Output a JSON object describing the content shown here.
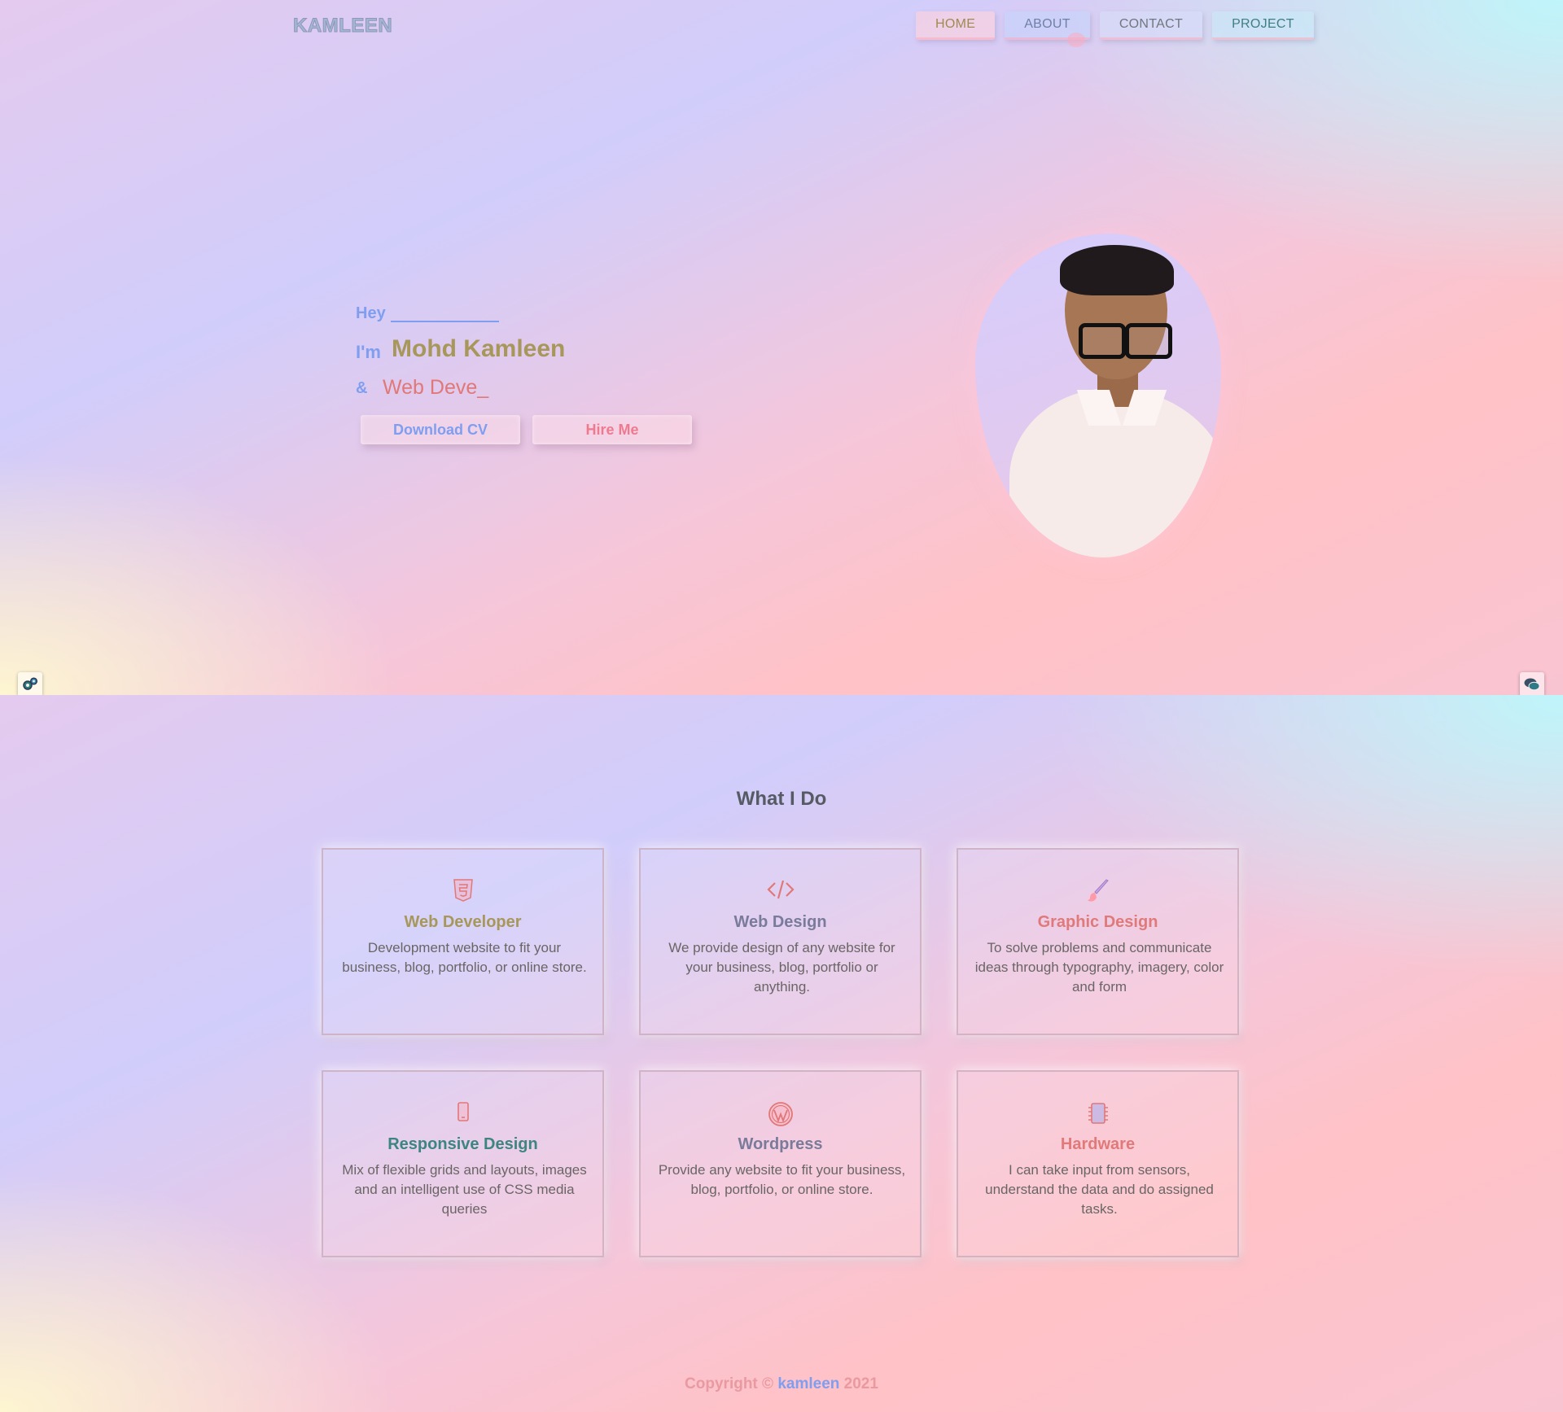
{
  "nav": {
    "logo": "KAMLEEN",
    "items": [
      {
        "label": "HOME"
      },
      {
        "label": "ABOUT"
      },
      {
        "label": "CONTACT"
      },
      {
        "label": "PROJECT"
      }
    ]
  },
  "hero": {
    "hey": "Hey",
    "im": "I'm",
    "name": "Mohd Kamleen",
    "amp": "&",
    "role": "Web Deve_",
    "download_cv": "Download CV",
    "hire_me": "Hire Me"
  },
  "services": {
    "title": "What I Do",
    "cards": [
      {
        "title": "Web Developer",
        "text": "Development website to fit your business, blog, portfolio, or online store.",
        "color": "#a7975a",
        "icon": "html5-icon"
      },
      {
        "title": "Web Design",
        "text": "We provide design of any website for your business, blog, portfolio or anything.",
        "color": "#7a7b9a",
        "icon": "code-icon"
      },
      {
        "title": "Graphic Design",
        "text": "To solve problems and communicate ideas through typography, imagery, color and form",
        "color": "#e07a7a",
        "icon": "paintbrush-icon"
      },
      {
        "title": "Responsive Design",
        "text": "Mix of flexible grids and layouts, images and an intelligent use of CSS media queries",
        "color": "#3d8580",
        "icon": "mobile-icon"
      },
      {
        "title": "Wordpress",
        "text": "Provide any website to fit your business, blog, portfolio, or online store.",
        "color": "#7a7b9a",
        "icon": "wordpress-icon"
      },
      {
        "title": "Hardware",
        "text": "I can take input from sensors, understand the data and do assigned tasks.",
        "color": "#e07a7a",
        "icon": "chip-icon"
      }
    ]
  },
  "footer": {
    "prefix": "Copyright ©",
    "brand": "kamleen",
    "year": "2021"
  }
}
